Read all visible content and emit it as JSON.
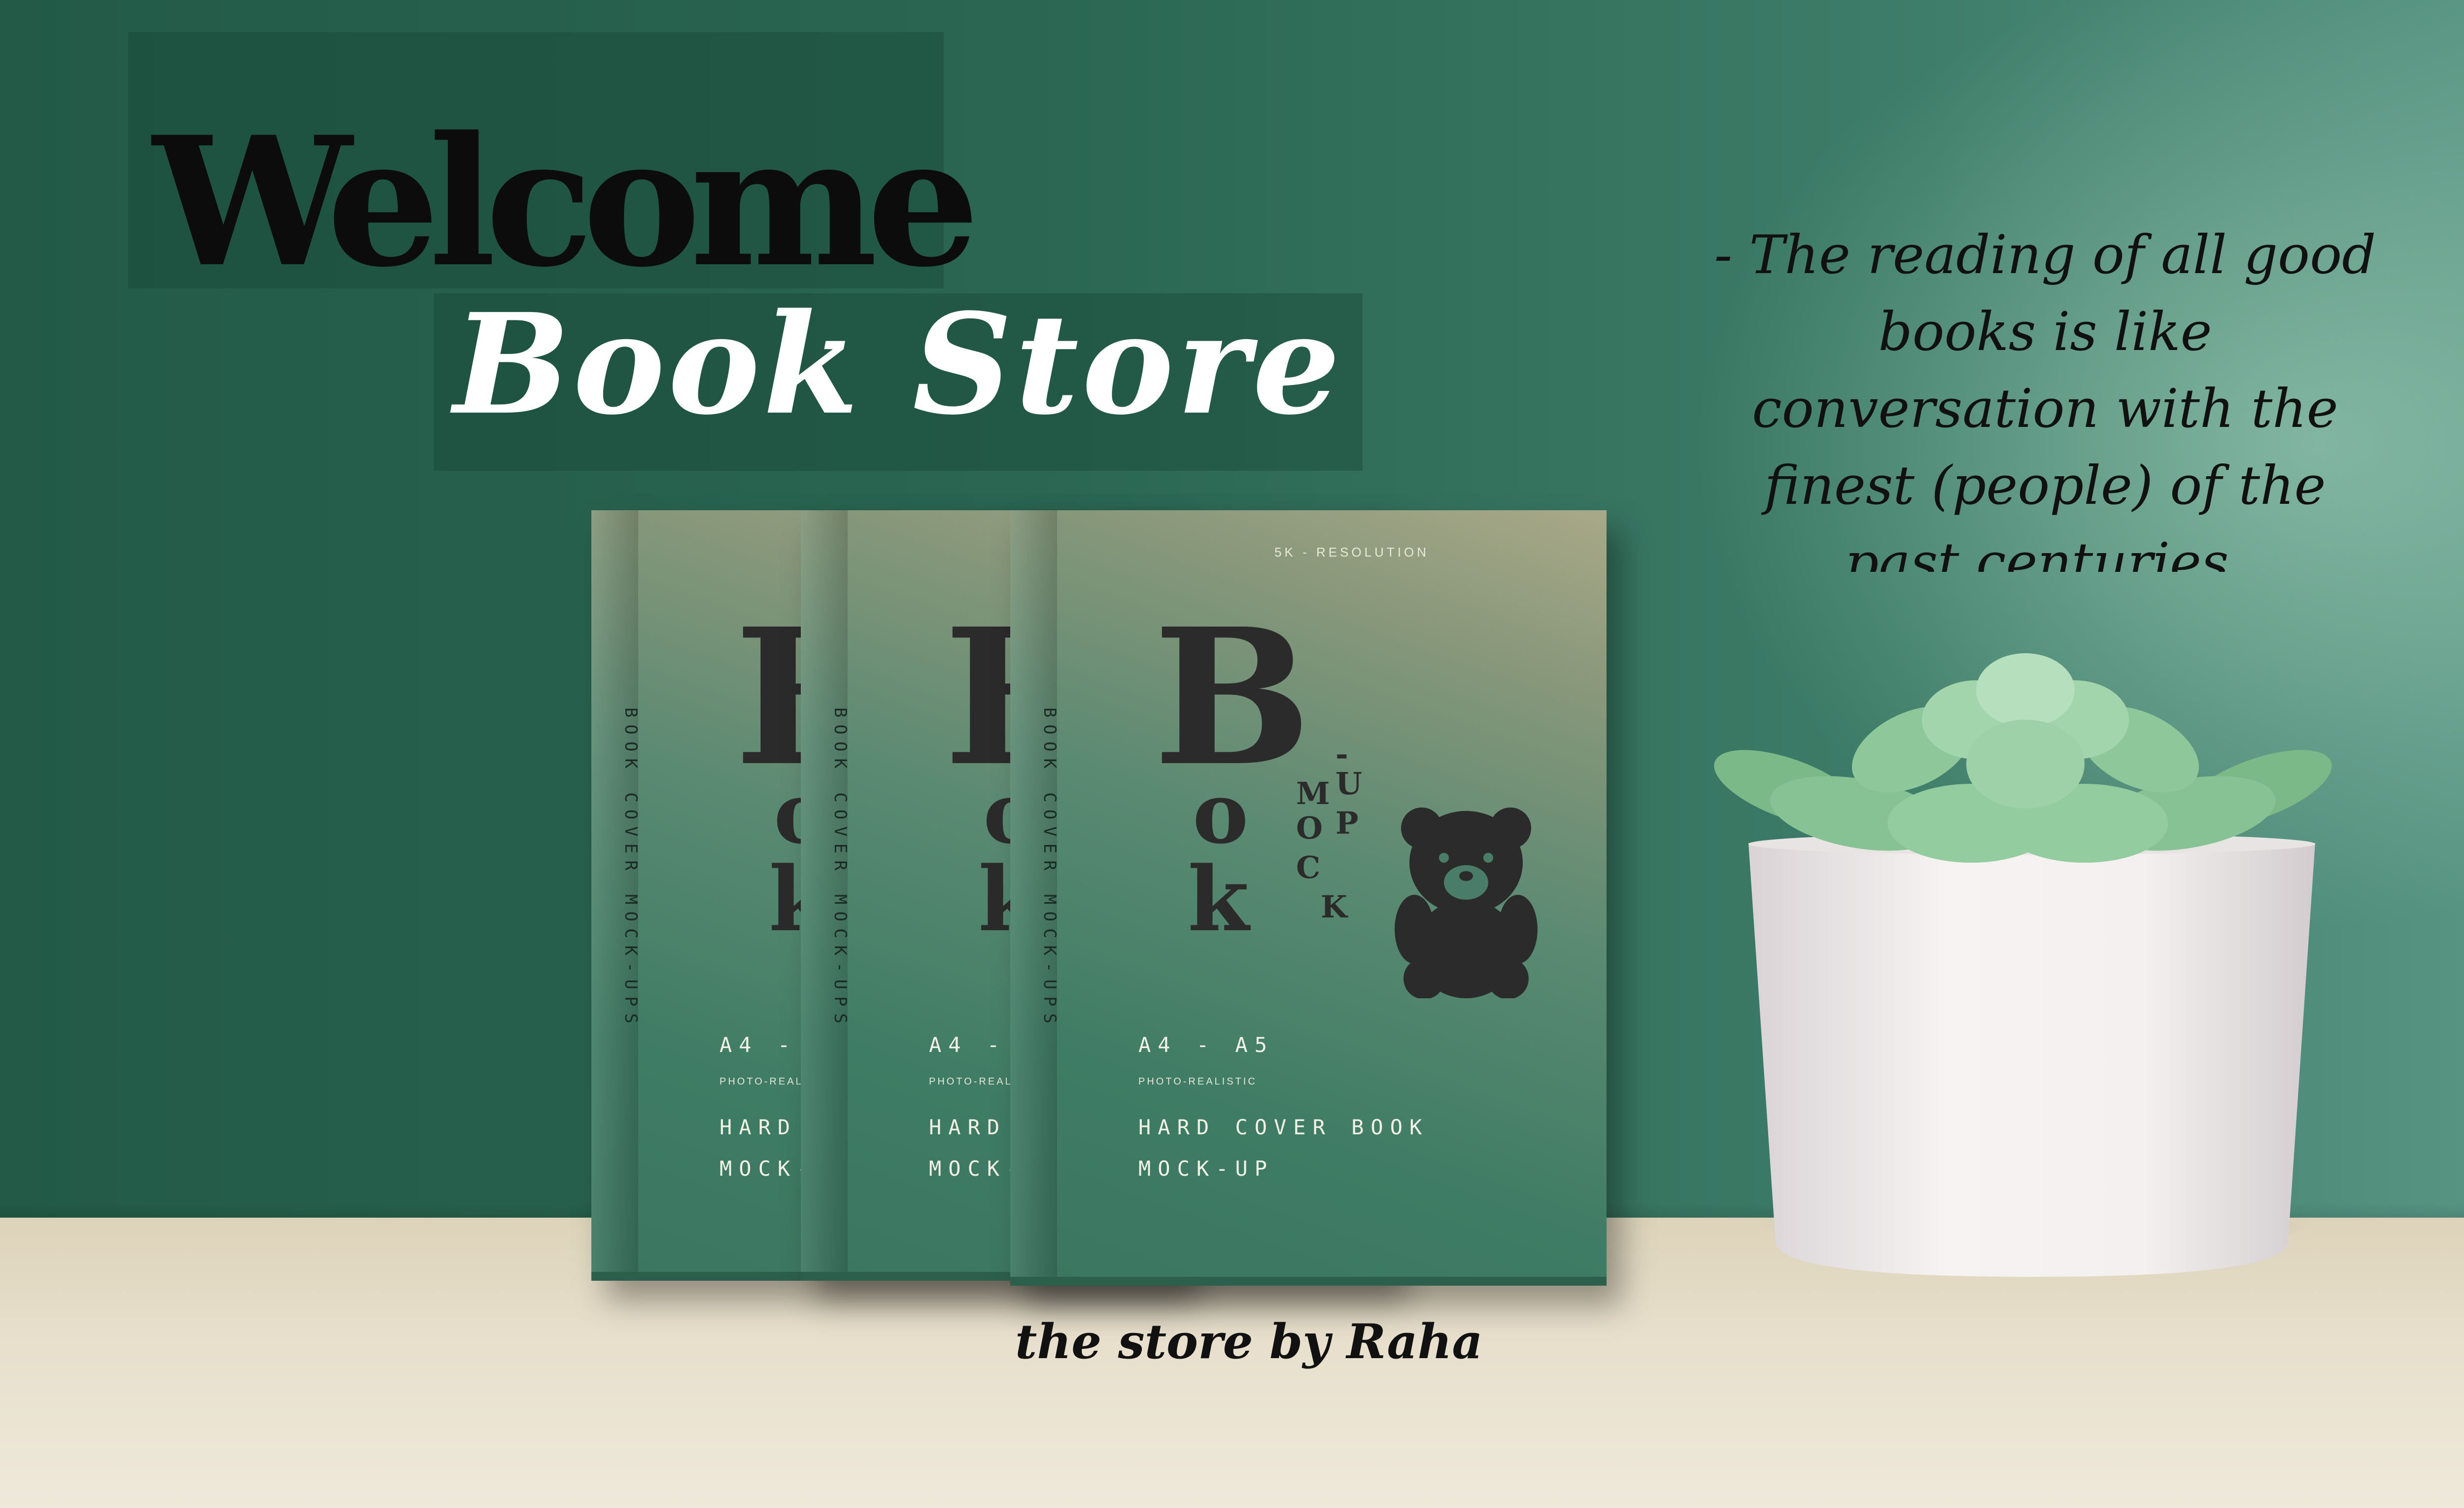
{
  "banner": {
    "welcome": "Welcome",
    "store_name": "Book Store"
  },
  "quote": {
    "text": "- The reading of all good books is like conversation with the finest (people) of the past centuries."
  },
  "signature": "the store by Raha",
  "book": {
    "spine": "BOOK COVER MOCK-UPS",
    "resolution": "5K - RESOLUTION",
    "logo_big": "B",
    "logo_o": "o",
    "logo_k": "k",
    "mockup_letters": [
      "-",
      "M",
      "U",
      "O",
      "P",
      "C",
      "K"
    ],
    "sizes": "A4 - A5",
    "photo": "PHOTO-REALISTIC",
    "line1": "HARD COVER BOOK",
    "line2": "MOCK-UP",
    "bear_icon": "teddy-bear-icon"
  },
  "colors": {
    "wall": "#2f6b55",
    "shelf": "#e7dfcb",
    "pot": "#f2efec",
    "succulent": "#8fc99c"
  }
}
